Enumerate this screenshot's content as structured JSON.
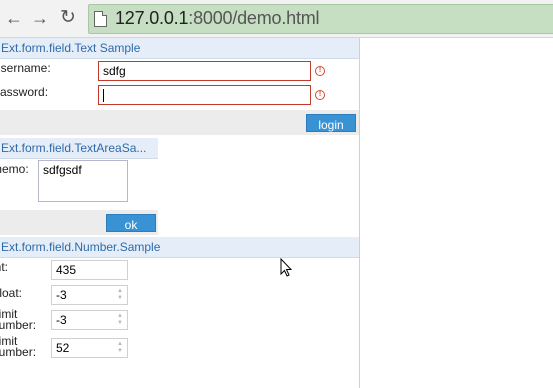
{
  "browser": {
    "url_host": "127.0.0.1",
    "url_rest": ":8000/demo.html",
    "icons": {
      "back": "back-arrow-icon",
      "forward": "forward-arrow-icon",
      "reload": "reload-icon",
      "page": "page-icon"
    }
  },
  "text_panel": {
    "title": "Ext.form.field.Text Sample",
    "username_label": "Username:",
    "username_value": "sdfg",
    "password_label": "Password:",
    "password_value": "",
    "login_button": "login"
  },
  "textarea_panel": {
    "title": "Ext.form.field.TextAreaSa...",
    "memo_label": "memo:",
    "memo_value": "sdfgsdf",
    "ok_button": "ok"
  },
  "number_panel": {
    "title": "Ext.form.field.Number.Sample",
    "int_label": "int:",
    "int_value": "435",
    "float_label": "Float:",
    "float_value": "-3",
    "limit_label_1_line1": "Limit",
    "limit_label_1_line2": "number:",
    "limit_value_1": "-3",
    "limit_label_2_line1": "Limit",
    "limit_label_2_line2": "number:",
    "limit_value_2": "52"
  },
  "colors": {
    "accent": "#3892d4",
    "header_text": "#2e6aa8",
    "error": "#c0392b"
  }
}
